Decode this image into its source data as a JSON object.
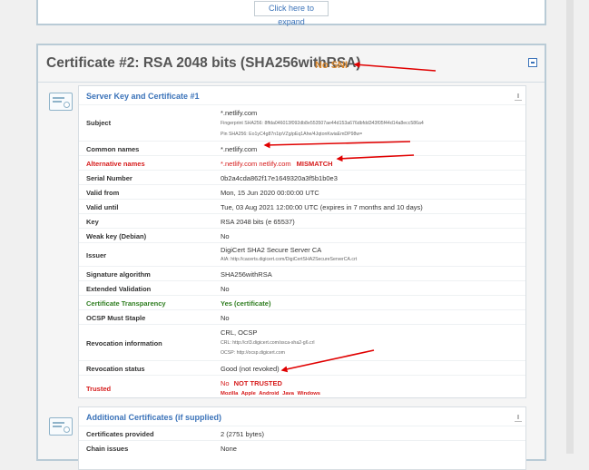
{
  "top_panel": {
    "expand_label": "Click here to expand"
  },
  "certificate": {
    "title": "Certificate #2: RSA 2048 bits (SHA256withRSA)",
    "no_sni": "No SNI",
    "server_section": {
      "title": "Server Key and Certificate #1",
      "subject": {
        "label": "Subject",
        "value": "*.netlify.com",
        "fingerprint": "Fingerprint SHA256: 8ffda046013f092db8e553507ae44d153a676dbfdd343f05f44d14a8ecc586a4",
        "pin": "Pin SHA256: Eo1yC4g87n1ipVZg/pEq1Ahe/4JqtonKwiaEmDP98w="
      },
      "common_names": {
        "label": "Common names",
        "value": "*.netlify.com"
      },
      "alternative_names": {
        "label": "Alternative names",
        "value": "*.netlify.com netlify.com",
        "status": "MISMATCH"
      },
      "serial_number": {
        "label": "Serial Number",
        "value": "0b2a4cda862f17e1649320a3f5b1b0e3"
      },
      "valid_from": {
        "label": "Valid from",
        "value": "Mon, 15 Jun 2020 00:00:00 UTC"
      },
      "valid_until": {
        "label": "Valid until",
        "value": "Tue, 03 Aug 2021 12:00:00 UTC (expires in 7 months and 10 days)"
      },
      "key": {
        "label": "Key",
        "value": "RSA 2048 bits (e 65537)"
      },
      "weak_key": {
        "label": "Weak key (Debian)",
        "value": "No"
      },
      "issuer": {
        "label": "Issuer",
        "value": "DigiCert SHA2 Secure Server CA",
        "aia": "AIA: http://cacerts.digicert.com/DigiCertSHA2SecureServerCA.crt"
      },
      "signature_algorithm": {
        "label": "Signature algorithm",
        "value": "SHA256withRSA"
      },
      "extended_validation": {
        "label": "Extended Validation",
        "value": "No"
      },
      "certificate_transparency": {
        "label": "Certificate Transparency",
        "value": "Yes (certificate)"
      },
      "ocsp_must_staple": {
        "label": "OCSP Must Staple",
        "value": "No"
      },
      "revocation_information": {
        "label": "Revocation information",
        "value": "CRL, OCSP",
        "crl": "CRL: http://crl3.digicert.com/ssca-sha2-g6.crl",
        "ocsp": "OCSP: http://ocsp.digicert.com"
      },
      "revocation_status": {
        "label": "Revocation status",
        "value": "Good (not revoked)"
      },
      "trusted": {
        "label": "Trusted",
        "value": "No",
        "status": "NOT TRUSTED",
        "browsers": [
          "Mozilla",
          "Apple",
          "Android",
          "Java",
          "Windows"
        ]
      }
    },
    "additional_section": {
      "title": "Additional Certificates (if supplied)",
      "certificates_provided": {
        "label": "Certificates provided",
        "value": "2 (2751 bytes)"
      },
      "chain_issues": {
        "label": "Chain issues",
        "value": "None"
      }
    }
  },
  "colors": {
    "accent_blue": "#3b73b9",
    "warning_red": "#d61b1b",
    "no_sni_orange": "#d9862b",
    "trusted_green": "#2e7d1f",
    "annotation_arrow": "#e00000"
  }
}
